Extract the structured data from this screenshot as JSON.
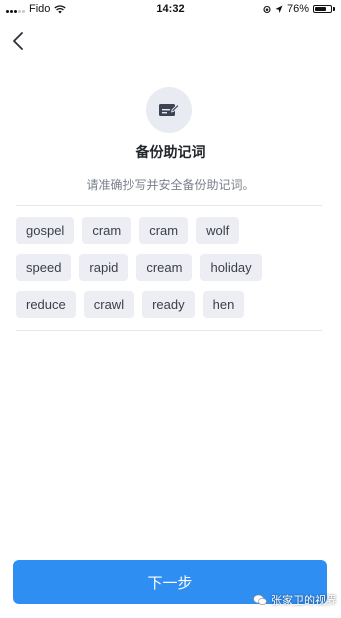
{
  "status_bar": {
    "carrier": "Fido",
    "time": "14:32",
    "battery_percent": "76%",
    "battery_level": 0.76,
    "signal_bars_filled": 3,
    "signal_bars_total": 5
  },
  "header": {
    "back_icon": "chevron-left-icon"
  },
  "backup": {
    "hero_icon": "edit-card-icon",
    "title": "备份助记词",
    "instruction": "请准确抄写并安全备份助记词。"
  },
  "mnemonic": {
    "rows": [
      [
        "gospel",
        "cram",
        "cram",
        "wolf"
      ],
      [
        "speed",
        "rapid",
        "cream",
        "holiday"
      ],
      [
        "reduce",
        "crawl",
        "ready",
        "hen"
      ]
    ]
  },
  "footer": {
    "next_label": "下一步"
  },
  "watermark": {
    "text": "张家卫的视界"
  },
  "colors": {
    "accent": "#2f8ef2",
    "chip_background": "#eceef4",
    "icon_background": "#e9ebf2"
  }
}
